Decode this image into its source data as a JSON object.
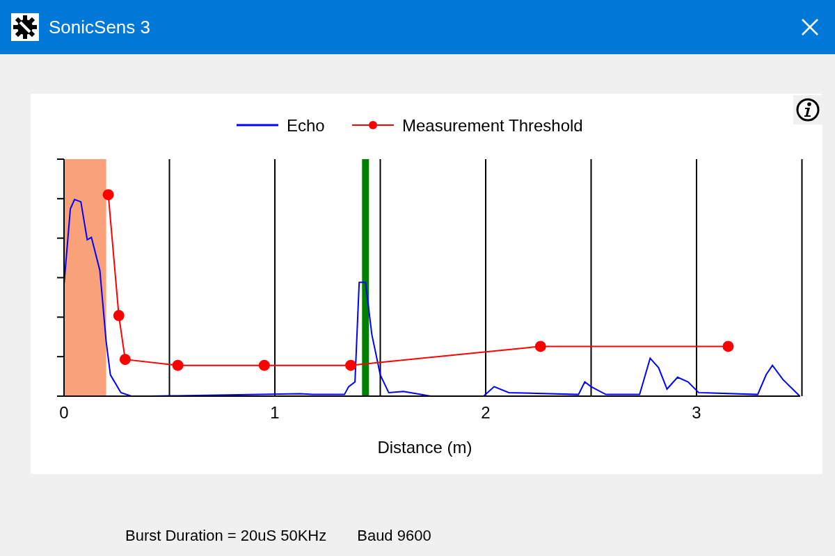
{
  "window": {
    "title": "SonicSens 3"
  },
  "chart": {
    "legend": [
      {
        "label": "Echo",
        "color": "#0000ff",
        "kind": "line"
      },
      {
        "label": "Measurement Threshold",
        "color": "#ff0000",
        "kind": "line-marker"
      }
    ],
    "x_ticks": [
      "0",
      "1",
      "2",
      "3"
    ],
    "x_axis_label": "Distance (m)"
  },
  "status": [
    {
      "text": "Burst Duration = 20uS 50KHz"
    },
    {
      "text": "Baud 9600"
    }
  ]
}
